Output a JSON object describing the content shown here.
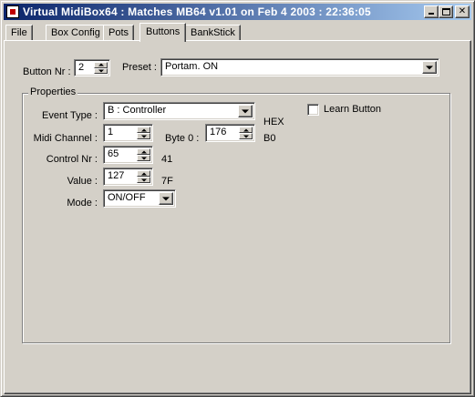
{
  "window": {
    "title": "Virtual MidiBox64 : Matches MB64 v1.01 on Feb  4 2003 : 22:36:05",
    "controls": {
      "minimize": "_",
      "maximize": "□",
      "close": "✕"
    }
  },
  "tabs": [
    {
      "label": "File",
      "active": false
    },
    {
      "label": "Box Config",
      "active": false
    },
    {
      "label": "Pots",
      "active": false
    },
    {
      "label": "Buttons",
      "active": true
    },
    {
      "label": "BankStick",
      "active": false
    }
  ],
  "button_nr": {
    "label": "Button Nr :",
    "value": "2"
  },
  "preset": {
    "label": "Preset :",
    "value": "Portam. ON"
  },
  "properties": {
    "title": "Properties",
    "event_type": {
      "label": "Event Type :",
      "value": "B : Controller"
    },
    "learn_button": {
      "label": "Learn Button",
      "checked": false
    },
    "hex_header": "HEX",
    "midi_channel": {
      "label": "Midi Channel :",
      "value": "1"
    },
    "byte0": {
      "label": "Byte 0 :",
      "value": "176",
      "hex": "B0"
    },
    "control_nr": {
      "label": "Control Nr :",
      "value": "65",
      "hex": "41"
    },
    "value": {
      "label": "Value :",
      "value": "127",
      "hex": "7F"
    },
    "mode": {
      "label": "Mode :",
      "value": "ON/OFF"
    }
  }
}
